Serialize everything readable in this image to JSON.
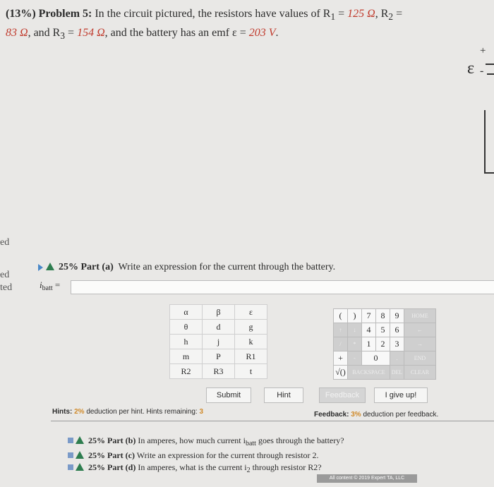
{
  "problem": {
    "prefix": "(13%) Problem 5:",
    "text_1": "In the circuit pictured, the resistors have values of R",
    "r1_sub": "1",
    "eq": " = ",
    "r1_val": "125 Ω",
    "text_2": ", R",
    "r2_sub": "2",
    "eq2": " =",
    "r2_val": "83 Ω",
    "text_3": ", and R",
    "r3_sub": "3",
    "eq3": " = ",
    "r3_val": "154 Ω",
    "text_4": ", and the battery has an emf ε = ",
    "emf_val": "203 V",
    "text_5": "."
  },
  "circuit": {
    "emf_symbol": "ε",
    "plus": "+",
    "minus": "-"
  },
  "side_words": [
    "ed",
    "ed",
    "ted"
  ],
  "part_a": {
    "label": "25% Part (a)",
    "prompt": "Write an expression for the current through the battery."
  },
  "answer": {
    "var_prefix": "i",
    "var_sub": "batt",
    "equals": " ="
  },
  "keypad": {
    "rows": [
      [
        "α",
        "β",
        "ε"
      ],
      [
        "θ",
        "d",
        "g"
      ],
      [
        "h",
        "j",
        "k"
      ],
      [
        "m",
        "P",
        "R1"
      ],
      [
        "R2",
        "R3",
        "t"
      ]
    ],
    "numbers": [
      [
        "(",
        ")",
        "7",
        "8",
        "9",
        "HOME"
      ],
      [
        "↑",
        "↓",
        "4",
        "5",
        "6",
        "←"
      ],
      [
        "/",
        "*",
        "1",
        "2",
        "3",
        "→"
      ],
      [
        "+",
        "-",
        "0",
        ".",
        "",
        "END"
      ],
      [
        "√()",
        "BACKSPACE",
        "",
        "DEL",
        "",
        "CLEAR"
      ]
    ]
  },
  "buttons": {
    "submit": "Submit",
    "hint": "Hint",
    "feedback": "Feedback",
    "give_up": "I give up!"
  },
  "hints": {
    "label": "Hints:",
    "pct": "2%",
    "text": "deduction per hint. Hints remaining:",
    "remaining": "3"
  },
  "feedback_info": {
    "label": "Feedback:",
    "pct": "3%",
    "text": "deduction per feedback."
  },
  "other_parts": [
    {
      "label": "25% Part (b)",
      "text": "In amperes, how much current i",
      "sub": "batt",
      "text2": " goes through the battery?"
    },
    {
      "label": "25% Part (c)",
      "text": "Write an expression for the current through resistor 2.",
      "sub": "",
      "text2": ""
    },
    {
      "label": "25% Part (d)",
      "text": "In amperes, what is the current i",
      "sub": "2",
      "text2": " through resistor R2?"
    }
  ],
  "footer": "All content © 2019 Expert TA, LLC"
}
